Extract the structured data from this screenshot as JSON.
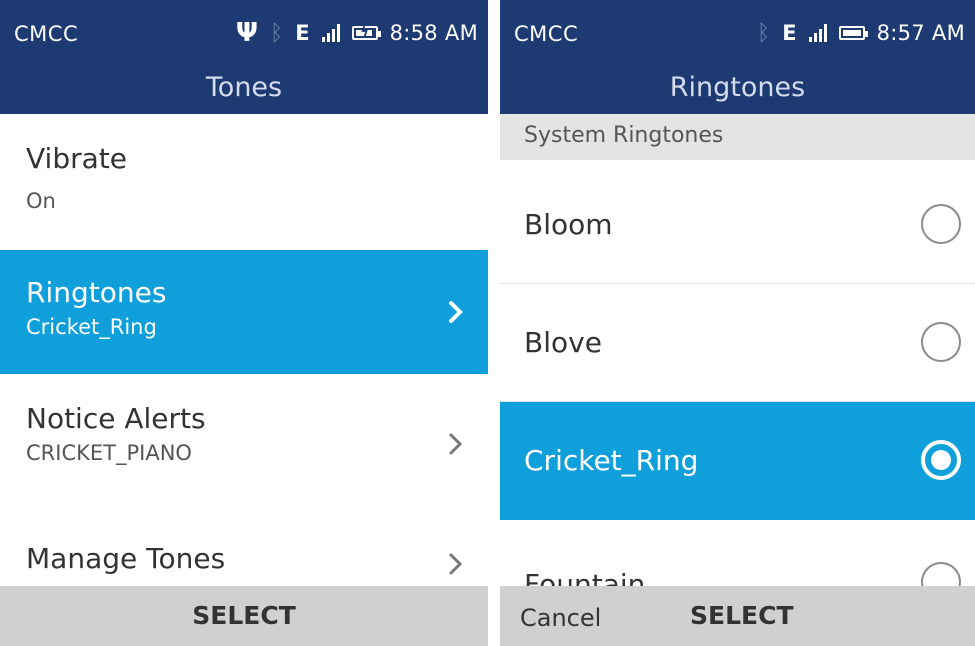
{
  "left": {
    "status": {
      "carrier": "CMCC",
      "time": "8:58 AM",
      "net": "E"
    },
    "title": "Tones",
    "items": [
      {
        "label": "Vibrate",
        "value": "On"
      },
      {
        "label": "Ringtones",
        "value": "Cricket_Ring",
        "selected": true
      },
      {
        "label": "Notice Alerts",
        "value": "CRICKET_PIANO"
      },
      {
        "label": "Manage Tones"
      }
    ],
    "softkeys": {
      "center": "SELECT"
    }
  },
  "right": {
    "status": {
      "carrier": "CMCC",
      "time": "8:57 AM",
      "net": "E"
    },
    "title": "Ringtones",
    "section_header": "System Ringtones",
    "options": [
      {
        "label": "Bloom",
        "checked": false
      },
      {
        "label": "Blove",
        "checked": false
      },
      {
        "label": "Cricket_Ring",
        "checked": true
      },
      {
        "label": "Fountain",
        "checked": false
      }
    ],
    "softkeys": {
      "left": "Cancel",
      "center": "SELECT"
    }
  },
  "colors": {
    "header": "#1e3a72",
    "accent": "#0f9fdb",
    "softkey_bar": "#d0d0d0",
    "section_header": "#e4e4e4"
  },
  "icons": [
    "usb-icon",
    "bluetooth-icon",
    "signal-icon",
    "battery-icon",
    "chevron-right-icon",
    "radio-icon"
  ]
}
